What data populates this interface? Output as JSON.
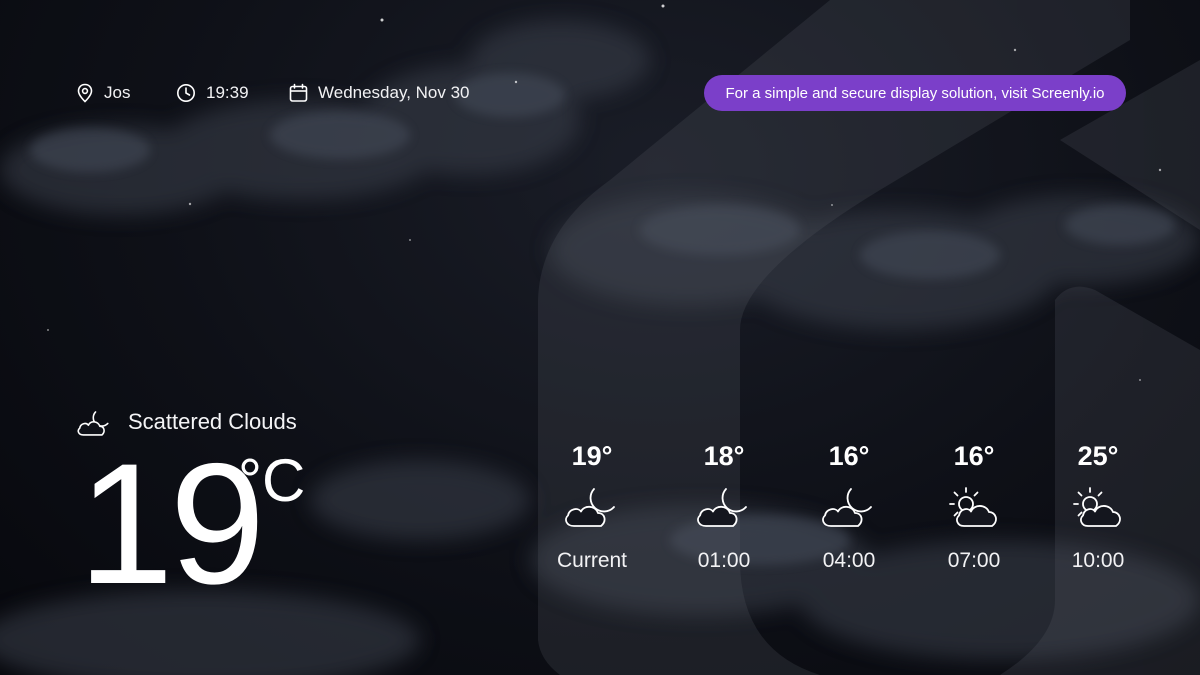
{
  "header": {
    "location": "Jos",
    "time": "19:39",
    "date": "Wednesday, Nov 30",
    "promo_text": "For a simple and secure display solution, visit Screenly.io"
  },
  "current": {
    "condition": "Scattered Clouds",
    "icon": "cloud-moon-icon",
    "temperature": "19",
    "unit": "°C"
  },
  "forecast": [
    {
      "temp": "19°",
      "icon": "cloud-moon-icon",
      "time": "Current"
    },
    {
      "temp": "18°",
      "icon": "cloud-moon-icon",
      "time": "01:00"
    },
    {
      "temp": "16°",
      "icon": "cloud-moon-icon",
      "time": "04:00"
    },
    {
      "temp": "16°",
      "icon": "cloud-sun-icon",
      "time": "07:00"
    },
    {
      "temp": "25°",
      "icon": "cloud-sun-icon",
      "time": "10:00"
    }
  ],
  "colors": {
    "accent": "#7b3fc9",
    "background": "#0b0d14",
    "text": "#ffffff"
  }
}
